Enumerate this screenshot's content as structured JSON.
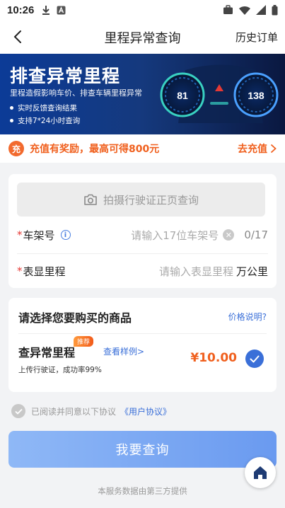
{
  "status_bar": {
    "time": "10:26"
  },
  "header": {
    "title": "里程异常查询",
    "history_label": "历史订单"
  },
  "banner": {
    "title": "排查异常里程",
    "subtitle": "里程造假影响车价、排查车辆里程异常",
    "bullets": [
      "实时反馈查询结果",
      "支持7*24小时查询"
    ],
    "gauge_left": "81",
    "gauge_right": "138"
  },
  "promo": {
    "badge": "充",
    "text": "充值有奖励，最高可得800元",
    "link": "去充值"
  },
  "form": {
    "photo_button": "拍摄行驶证正页查询",
    "vin": {
      "required_mark": "*",
      "label": "车架号",
      "info": "i",
      "placeholder": "请输入17位车架号",
      "counter": "0/17"
    },
    "mileage": {
      "required_mark": "*",
      "label": "表显里程",
      "placeholder": "请输入表显里程",
      "unit": "万公里"
    }
  },
  "product": {
    "heading": "请选择您要购买的商品",
    "price_help": "价格说明?",
    "name": "查异常里程",
    "tag": "推荐",
    "example": "查看样例>",
    "desc": "上传行驶证，成功率99%",
    "price": "¥10.00"
  },
  "agreement": {
    "text": "已阅读并同意以下协议",
    "link": "《用户协议》"
  },
  "submit_label": "我要查询",
  "footer": "本服务数据由第三方提供",
  "colors": {
    "accent": "#3a6fd8",
    "orange": "#f0601e",
    "banner": "#0c3b97"
  }
}
